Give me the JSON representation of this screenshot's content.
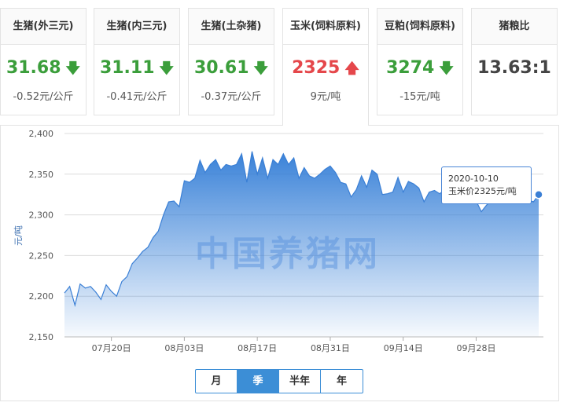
{
  "cards": [
    {
      "title": "生猪(外三元)",
      "price": "31.68",
      "arrow": "down",
      "change": "-0.52元/公斤"
    },
    {
      "title": "生猪(内三元)",
      "price": "31.11",
      "arrow": "down",
      "change": "-0.41元/公斤"
    },
    {
      "title": "生猪(土杂猪)",
      "price": "30.61",
      "arrow": "down",
      "change": "-0.37元/公斤"
    },
    {
      "title": "玉米(饲料原料)",
      "price": "2325",
      "arrow": "up",
      "change": "9元/吨"
    },
    {
      "title": "豆粕(饲料原料)",
      "price": "3274",
      "arrow": "down",
      "change": "-15元/吨"
    },
    {
      "title": "猪粮比",
      "price": "13.63:1",
      "arrow": "none",
      "change": ""
    }
  ],
  "icons": {
    "down": "arrow-down-icon",
    "up": "arrow-up-icon"
  },
  "colors": {
    "down": "#3b9e3b",
    "up": "#e5474b",
    "accent": "#3c8ed6",
    "area_top": "#2f7bd6"
  },
  "watermark": "中国养猪网",
  "tooltip": {
    "date": "2020-10-10",
    "text": "玉米价2325元/吨"
  },
  "tabs": [
    {
      "label": "月",
      "active": false
    },
    {
      "label": "季",
      "active": true
    },
    {
      "label": "半年",
      "active": false
    },
    {
      "label": "年",
      "active": false
    }
  ],
  "chart_data": {
    "type": "area",
    "ylabel": "元/吨",
    "ylim": [
      2150,
      2400
    ],
    "yticks": [
      "2,150",
      "2,200",
      "2,250",
      "2,300",
      "2,350",
      "2,400"
    ],
    "xticks": [
      {
        "label": "07月20日",
        "date": "2020-07-20"
      },
      {
        "label": "08月03日",
        "date": "2020-08-03"
      },
      {
        "label": "08月17日",
        "date": "2020-08-17"
      },
      {
        "label": "08月31日",
        "date": "2020-08-31"
      },
      {
        "label": "09月14日",
        "date": "2020-09-14"
      },
      {
        "label": "09月28日",
        "date": "2020-09-28"
      }
    ],
    "grid": true,
    "x": [
      "2020-07-11",
      "2020-07-12",
      "2020-07-13",
      "2020-07-14",
      "2020-07-15",
      "2020-07-16",
      "2020-07-17",
      "2020-07-18",
      "2020-07-19",
      "2020-07-20",
      "2020-07-21",
      "2020-07-22",
      "2020-07-23",
      "2020-07-24",
      "2020-07-25",
      "2020-07-26",
      "2020-07-27",
      "2020-07-28",
      "2020-07-29",
      "2020-07-30",
      "2020-07-31",
      "2020-08-01",
      "2020-08-02",
      "2020-08-03",
      "2020-08-04",
      "2020-08-05",
      "2020-08-06",
      "2020-08-07",
      "2020-08-08",
      "2020-08-09",
      "2020-08-10",
      "2020-08-11",
      "2020-08-12",
      "2020-08-13",
      "2020-08-14",
      "2020-08-15",
      "2020-08-16",
      "2020-08-17",
      "2020-08-18",
      "2020-08-19",
      "2020-08-20",
      "2020-08-21",
      "2020-08-22",
      "2020-08-23",
      "2020-08-24",
      "2020-08-25",
      "2020-08-26",
      "2020-08-27",
      "2020-08-28",
      "2020-08-29",
      "2020-08-30",
      "2020-08-31",
      "2020-09-01",
      "2020-09-02",
      "2020-09-03",
      "2020-09-04",
      "2020-09-05",
      "2020-09-06",
      "2020-09-07",
      "2020-09-08",
      "2020-09-09",
      "2020-09-10",
      "2020-09-11",
      "2020-09-12",
      "2020-09-13",
      "2020-09-14",
      "2020-09-15",
      "2020-09-16",
      "2020-09-17",
      "2020-09-18",
      "2020-09-19",
      "2020-09-20",
      "2020-09-21",
      "2020-09-22",
      "2020-09-23",
      "2020-09-24",
      "2020-09-25",
      "2020-09-26",
      "2020-09-27",
      "2020-09-28",
      "2020-09-29",
      "2020-09-30",
      "2020-10-01",
      "2020-10-02",
      "2020-10-03",
      "2020-10-04",
      "2020-10-05",
      "2020-10-06",
      "2020-10-07",
      "2020-10-08",
      "2020-10-09",
      "2020-10-10"
    ],
    "values": [
      2204,
      2212,
      2189,
      2215,
      2210,
      2212,
      2205,
      2196,
      2214,
      2206,
      2200,
      2218,
      2224,
      2240,
      2247,
      2255,
      2260,
      2272,
      2280,
      2300,
      2316,
      2317,
      2310,
      2342,
      2340,
      2345,
      2367,
      2352,
      2362,
      2368,
      2355,
      2362,
      2360,
      2362,
      2375,
      2340,
      2378,
      2350,
      2370,
      2345,
      2368,
      2362,
      2375,
      2362,
      2370,
      2345,
      2358,
      2348,
      2345,
      2350,
      2356,
      2360,
      2352,
      2340,
      2338,
      2322,
      2331,
      2348,
      2334,
      2355,
      2350,
      2325,
      2326,
      2328,
      2346,
      2328,
      2341,
      2338,
      2333,
      2316,
      2328,
      2330,
      2326,
      2331,
      2333,
      2329,
      2336,
      2328,
      2320,
      2317,
      2304,
      2312,
      2318,
      2314,
      2320,
      2318,
      2322,
      2323,
      2320,
      2318,
      2316,
      2325
    ],
    "tooltip_point": {
      "x": "2020-10-10",
      "y": 2325
    }
  }
}
